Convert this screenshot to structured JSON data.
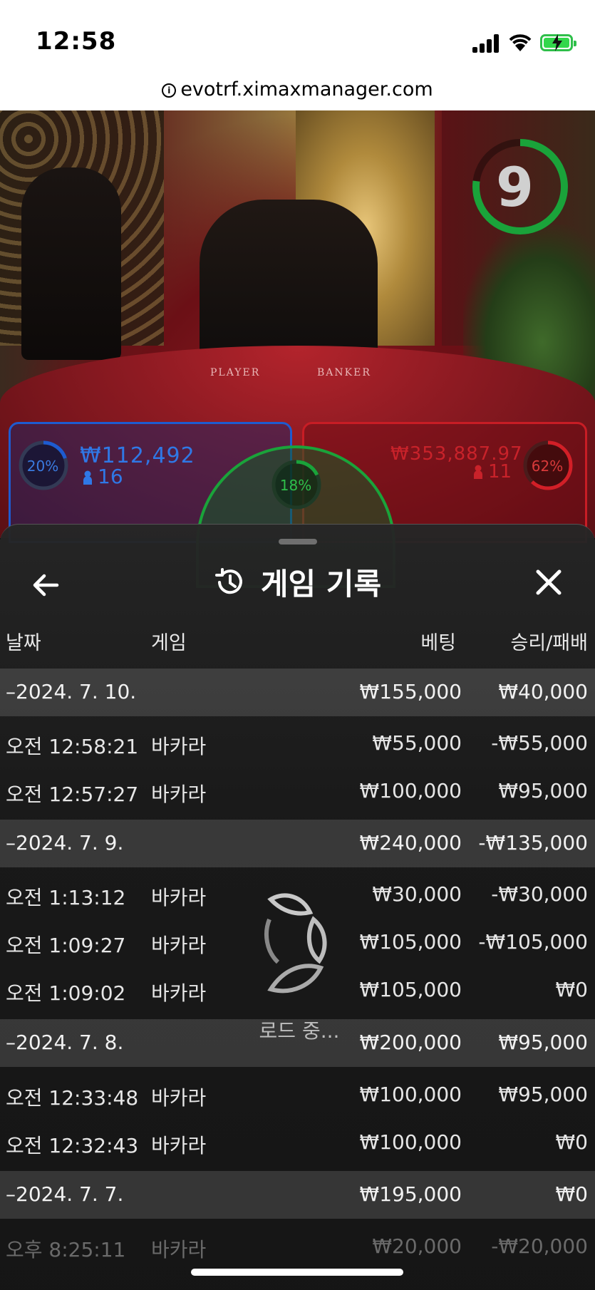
{
  "status": {
    "time": "12:58",
    "url": "evotrf.ximaxmanager.com"
  },
  "game": {
    "timer": "9",
    "table_labels": [
      "PLAYER",
      "BANKER"
    ],
    "player": {
      "pct": "20%",
      "amount": "₩112,492",
      "count": "16",
      "pct_value": 0.2
    },
    "banker": {
      "pct": "62%",
      "amount": "₩353,887.97",
      "count": "11",
      "pct_value": 0.62
    },
    "tie": {
      "pct": "18%",
      "pct_value": 0.18
    },
    "colors": {
      "player": "#1e5bd0",
      "banker": "#c81d25",
      "tie": "#1aa33a",
      "timer": "#1aa33a"
    }
  },
  "history": {
    "title": "게임 기록",
    "columns": {
      "date": "날짜",
      "game": "게임",
      "bet": "베팅",
      "win": "승리/패배"
    },
    "groups": [
      {
        "date": "–2024. 7. 10.",
        "bet": "₩155,000",
        "win": "₩40,000",
        "rows": [
          {
            "time": "오전 12:58:21",
            "game": "바카라",
            "bet": "₩55,000",
            "win": "-₩55,000"
          },
          {
            "time": "오전 12:57:27",
            "game": "바카라",
            "bet": "₩100,000",
            "win": "₩95,000"
          }
        ]
      },
      {
        "date": "–2024. 7. 9.",
        "bet": "₩240,000",
        "win": "-₩135,000",
        "rows": [
          {
            "time": "오전 1:13:12",
            "game": "바카라",
            "bet": "₩30,000",
            "win": "-₩30,000"
          },
          {
            "time": "오전 1:09:27",
            "game": "바카라",
            "bet": "₩105,000",
            "win": "-₩105,000"
          },
          {
            "time": "오전 1:09:02",
            "game": "바카라",
            "bet": "₩105,000",
            "win": "₩0"
          }
        ]
      },
      {
        "date": "–2024. 7. 8.",
        "bet": "₩200,000",
        "win": "₩95,000",
        "rows": [
          {
            "time": "오전 12:33:48",
            "game": "바카라",
            "bet": "₩100,000",
            "win": "₩95,000"
          },
          {
            "time": "오전 12:32:43",
            "game": "바카라",
            "bet": "₩100,000",
            "win": "₩0"
          }
        ]
      },
      {
        "date": "–2024. 7. 7.",
        "bet": "₩195,000",
        "win": "₩0",
        "rows": [
          {
            "time": "오후 8:25:11",
            "game": "바카라",
            "bet": "₩20,000",
            "win": "-₩20,000"
          }
        ]
      }
    ],
    "loading_text": "로드 중..."
  },
  "icons": [
    "info-icon",
    "signal-icon",
    "wifi-icon",
    "battery-icon",
    "back-arrow-icon",
    "history-icon",
    "close-icon",
    "person-icon",
    "loading-spinner-icon"
  ]
}
